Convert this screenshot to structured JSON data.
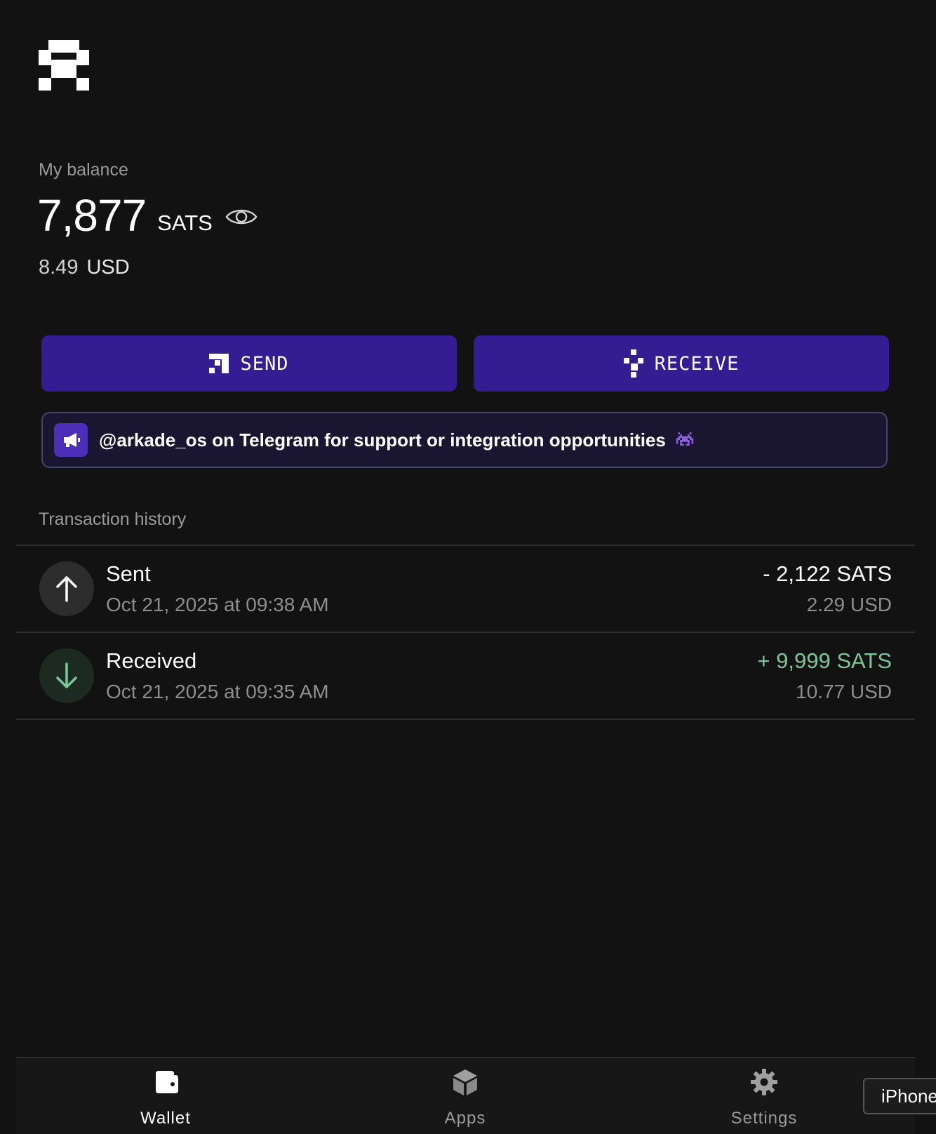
{
  "balance": {
    "label": "My balance",
    "amount": "7,877",
    "unit": "SATS",
    "fiat_amount": "8.49",
    "fiat_unit": "USD"
  },
  "actions": {
    "send_label": "SEND",
    "receive_label": "RECEIVE"
  },
  "announcement": {
    "text": "@arkade_os on Telegram for support or integration opportunities"
  },
  "history": {
    "label": "Transaction history",
    "transactions": [
      {
        "type": "sent",
        "title": "Sent",
        "date": "Oct 21, 2025 at 09:38 AM",
        "amount": "- 2,122 SATS",
        "fiat": "2.29 USD",
        "icon": "arrow-up-icon"
      },
      {
        "type": "received",
        "title": "Received",
        "date": "Oct 21, 2025 at 09:35 AM",
        "amount": "+ 9,999 SATS",
        "fiat": "10.77 USD",
        "icon": "arrow-down-icon"
      }
    ]
  },
  "nav": {
    "items": [
      {
        "label": "Wallet",
        "icon": "wallet-icon",
        "active": true
      },
      {
        "label": "Apps",
        "icon": "cube-icon",
        "active": false
      },
      {
        "label": "Settings",
        "icon": "gear-icon",
        "active": false
      }
    ]
  },
  "device_chip": {
    "label": "iPhone"
  },
  "colors": {
    "background": "#121212",
    "button": "#341c93",
    "positive": "#7bc79a",
    "muted": "#9a9a9a"
  }
}
